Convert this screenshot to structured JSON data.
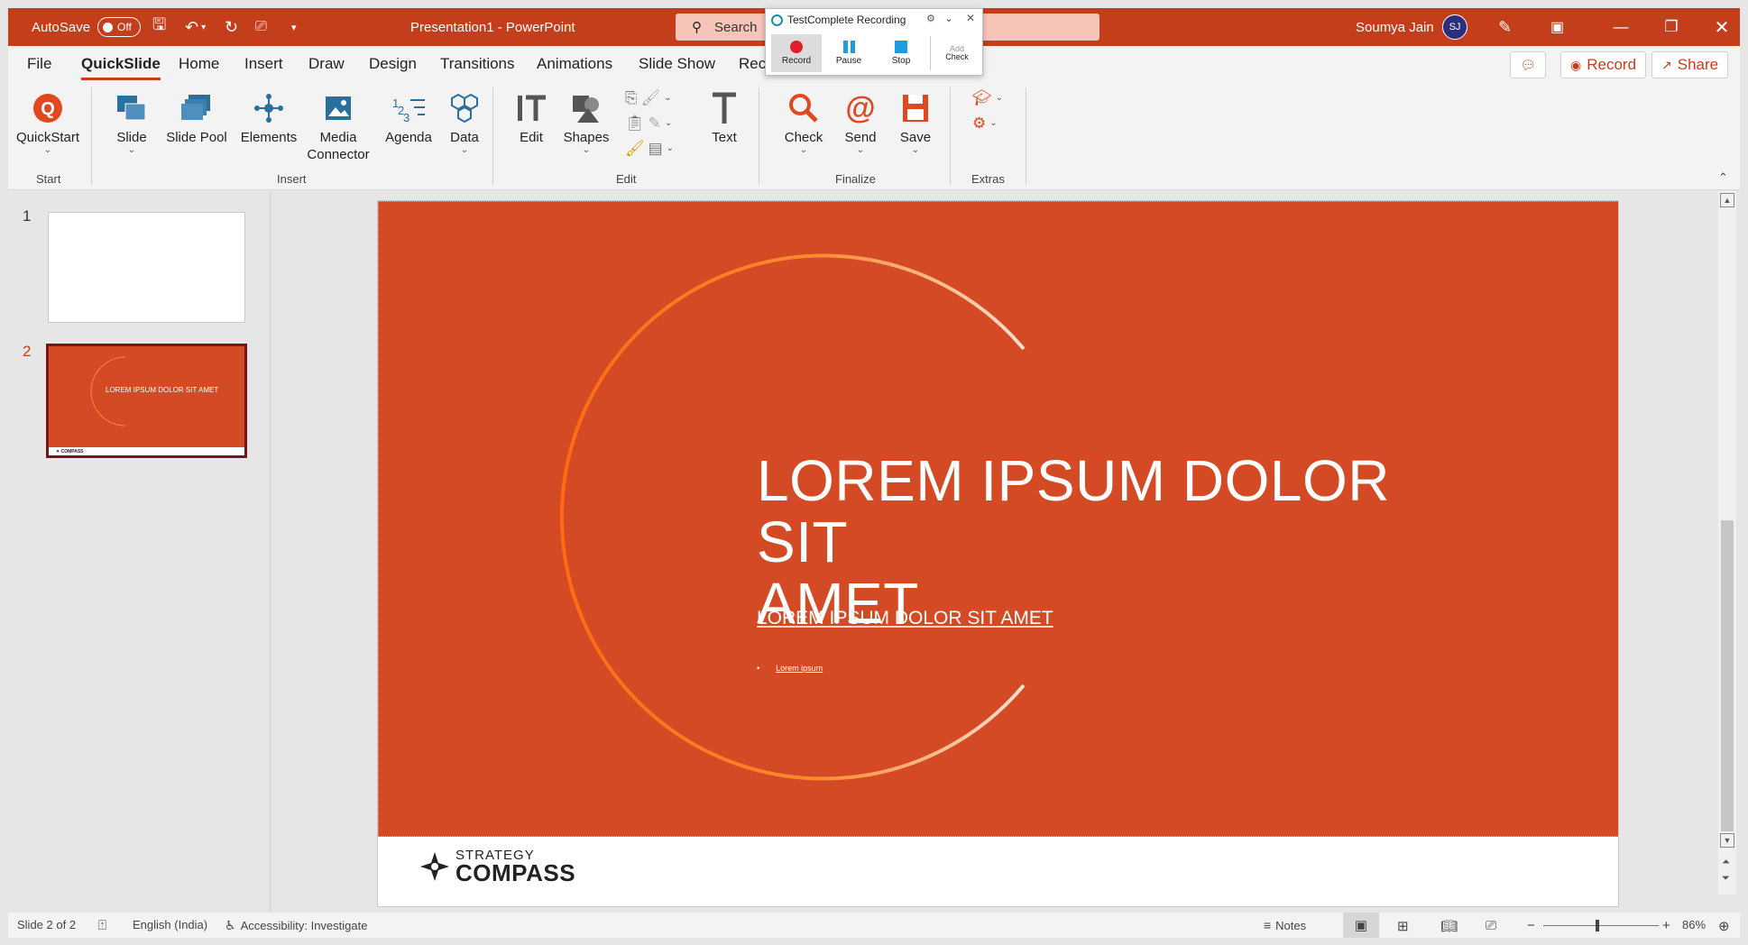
{
  "titlebar": {
    "autosave_label": "AutoSave",
    "autosave_state": "Off",
    "doc_title": "Presentation1  -  PowerPoint",
    "search_placeholder": "Search",
    "user_name": "Soumya Jain",
    "user_initials": "SJ",
    "accent": "#c43e1c"
  },
  "tabs": {
    "items": [
      "File",
      "QuickSlide",
      "Home",
      "Insert",
      "Draw",
      "Design",
      "Transitions",
      "Animations",
      "Slide Show",
      "Rec"
    ],
    "active": "QuickSlide",
    "record_label": "Record",
    "share_label": "Share"
  },
  "ribbon": {
    "start": {
      "quickstart": "QuickStart",
      "group": "Start"
    },
    "insert": {
      "slide": "Slide",
      "slide_pool": "Slide Pool",
      "elements": "Elements",
      "media_connector_1": "Media",
      "media_connector_2": "Connector",
      "agenda": "Agenda",
      "data": "Data",
      "group": "Insert"
    },
    "edit": {
      "edit": "Edit",
      "shapes": "Shapes",
      "text": "Text",
      "group": "Edit"
    },
    "finalize": {
      "check": "Check",
      "send": "Send",
      "save": "Save",
      "group": "Finalize"
    },
    "extras": {
      "group": "Extras"
    }
  },
  "testcomplete": {
    "title": "TestComplete Recording",
    "record": "Record",
    "pause": "Pause",
    "stop": "Stop",
    "check_top": "Add",
    "check": "Check"
  },
  "slides_panel": {
    "numbers": [
      "1",
      "2"
    ],
    "thumb2_title": "LOREM IPSUM DOLOR SIT AMET"
  },
  "slide": {
    "title_line1": "LOREM IPSUM DOLOR SIT",
    "title_line2": "AMET",
    "subtitle": "LOREM IPSUM DOLOR SIT AMET",
    "bullet": "Lorem ipsum",
    "logo_line1": "STRATEGY",
    "logo_line2": "COMPASS",
    "background": "#d34a24"
  },
  "statusbar": {
    "slide_info": "Slide 2 of 2",
    "language": "English (India)",
    "accessibility": "Accessibility: Investigate",
    "notes": "Notes",
    "zoom": "86%"
  }
}
